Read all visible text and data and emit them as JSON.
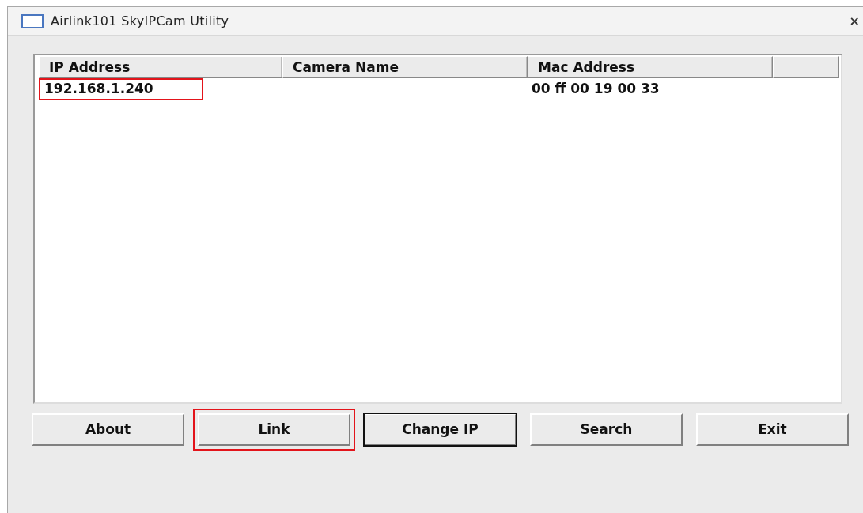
{
  "window": {
    "title": "Airlink101 SkyIPCam Utility",
    "close": "×"
  },
  "table": {
    "columns": [
      "IP Address",
      "Camera Name",
      "Mac Address",
      ""
    ],
    "rows": [
      {
        "cells": [
          {
            "text": "192.168.1.240",
            "highlighted": true
          },
          {
            "text": "",
            "highlighted": false
          },
          {
            "text": "00 ff 00 19 00 33",
            "highlighted": false
          }
        ]
      }
    ]
  },
  "buttons": [
    {
      "label": "About",
      "default": false,
      "highlighted": false
    },
    {
      "label": "Link",
      "default": false,
      "highlighted": true
    },
    {
      "label": "Change IP",
      "default": true,
      "highlighted": false
    },
    {
      "label": "Search",
      "default": false,
      "highlighted": false
    },
    {
      "label": "Exit",
      "default": false,
      "highlighted": false
    }
  ]
}
